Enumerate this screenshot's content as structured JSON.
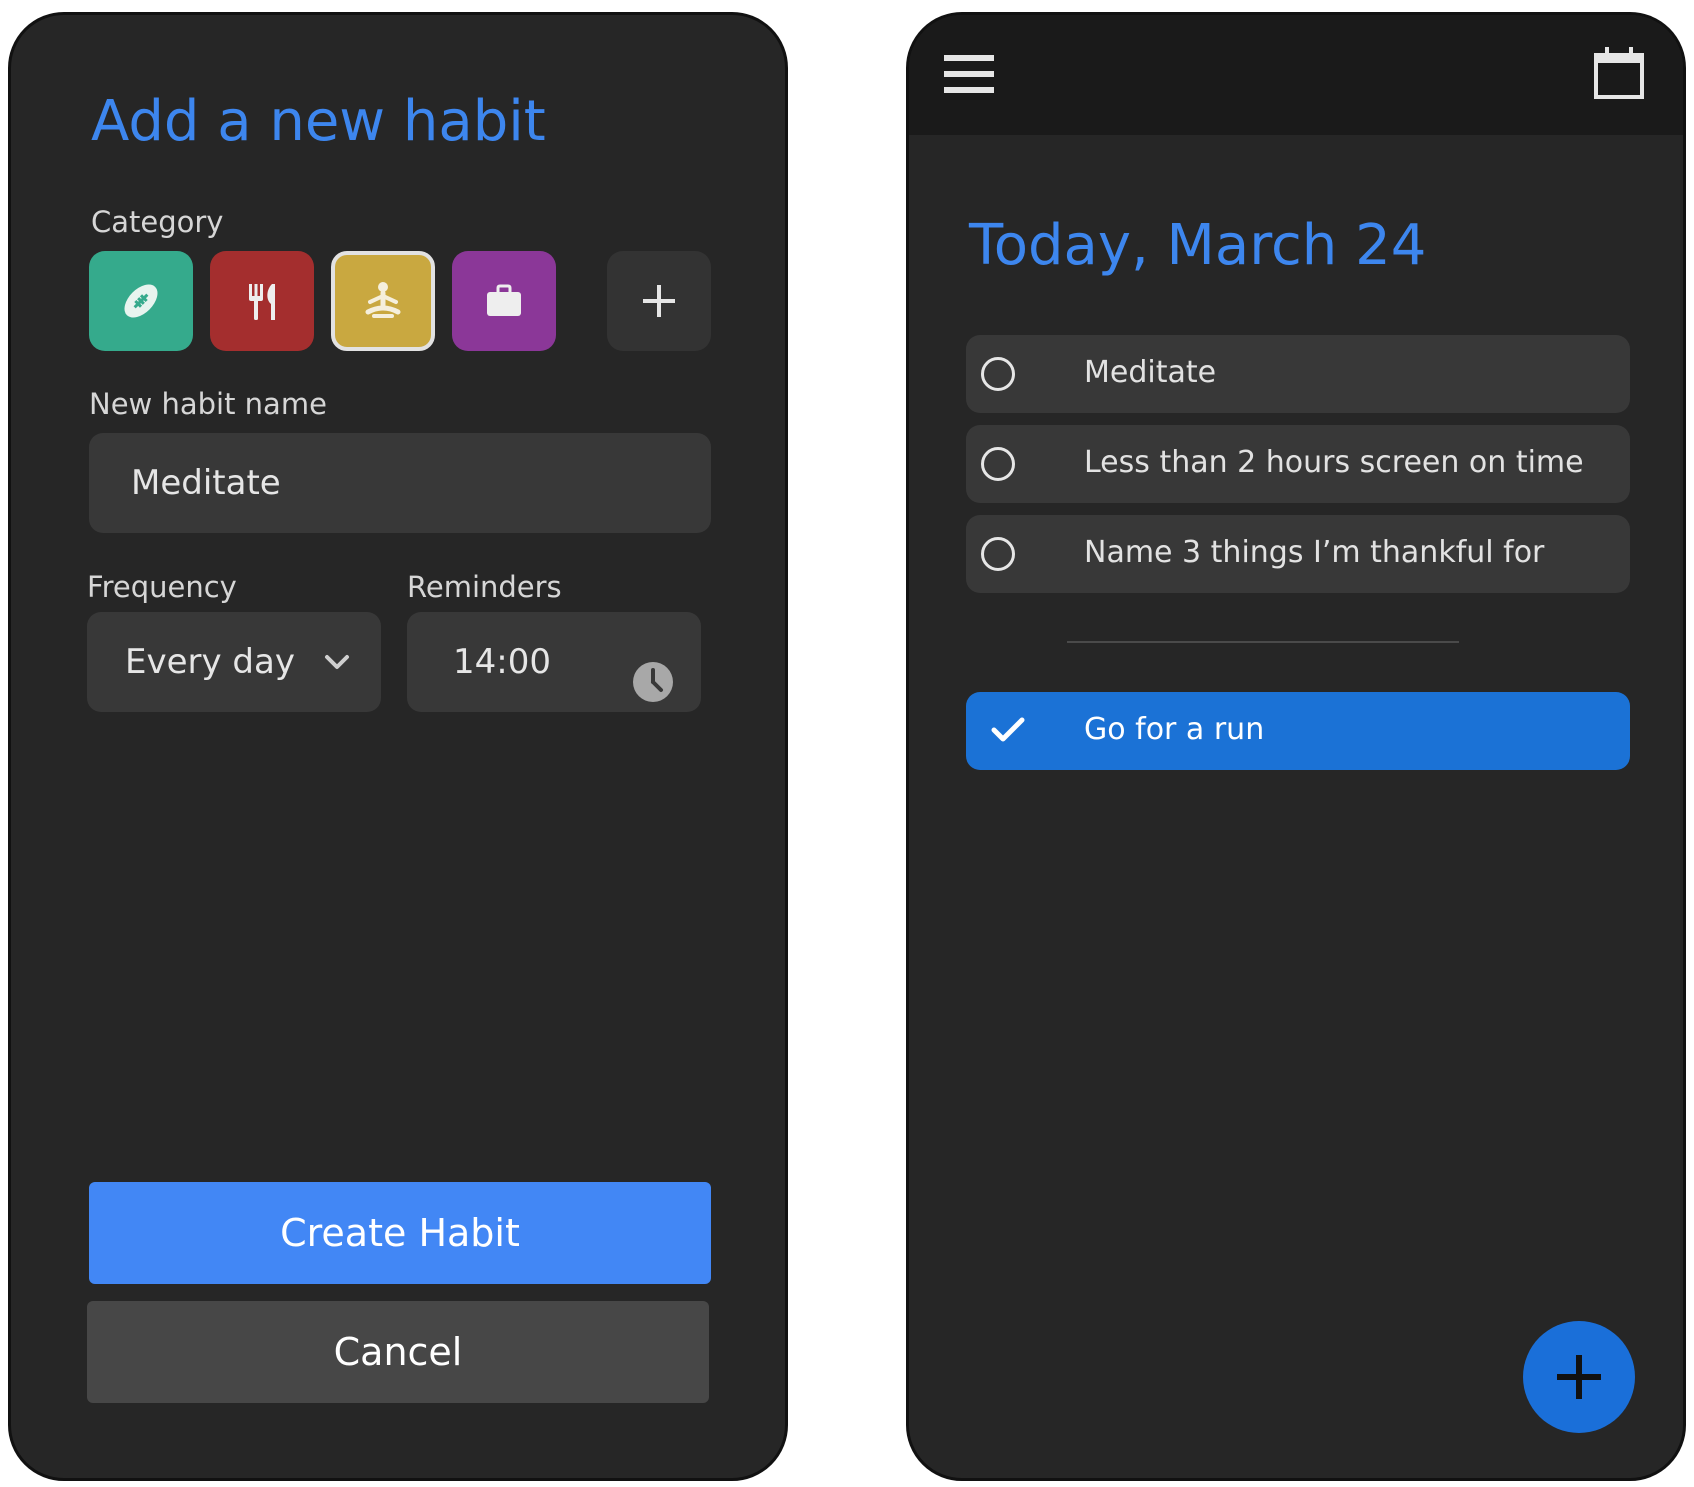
{
  "add_habit": {
    "title": "Add a new habit",
    "category_label": "Category",
    "categories": [
      {
        "name": "sports",
        "color": "#35aa8c",
        "icon": "football-icon"
      },
      {
        "name": "food",
        "color": "#a42e2e",
        "icon": "fork-knife-icon"
      },
      {
        "name": "mindfulness",
        "color": "#c9a840",
        "icon": "meditation-icon",
        "selected": true
      },
      {
        "name": "work",
        "color": "#8b3798",
        "icon": "briefcase-icon"
      }
    ],
    "add_category_icon": "plus-icon",
    "name_label": "New habit name",
    "name_value": "Meditate",
    "frequency_label": "Frequency",
    "frequency_value": "Every day",
    "reminders_label": "Reminders",
    "reminder_value": "14:00",
    "create_label": "Create Habit",
    "cancel_label": "Cancel"
  },
  "today": {
    "menu_icon": "hamburger-menu-icon",
    "calendar_icon": "calendar-icon",
    "title": "Today, March 24",
    "habits": [
      {
        "label": "Meditate",
        "done": false
      },
      {
        "label": "Less than 2 hours screen on time",
        "done": false
      },
      {
        "label": "Name 3 things I’m thankful for",
        "done": false
      }
    ],
    "completed": [
      {
        "label": "Go for a run",
        "done": true
      }
    ],
    "fab_icon": "plus-icon"
  },
  "colors": {
    "accent_blue": "#3d86ee",
    "primary_button": "#4287f5",
    "done_row": "#1b72d6",
    "panel_bg": "#262626"
  }
}
